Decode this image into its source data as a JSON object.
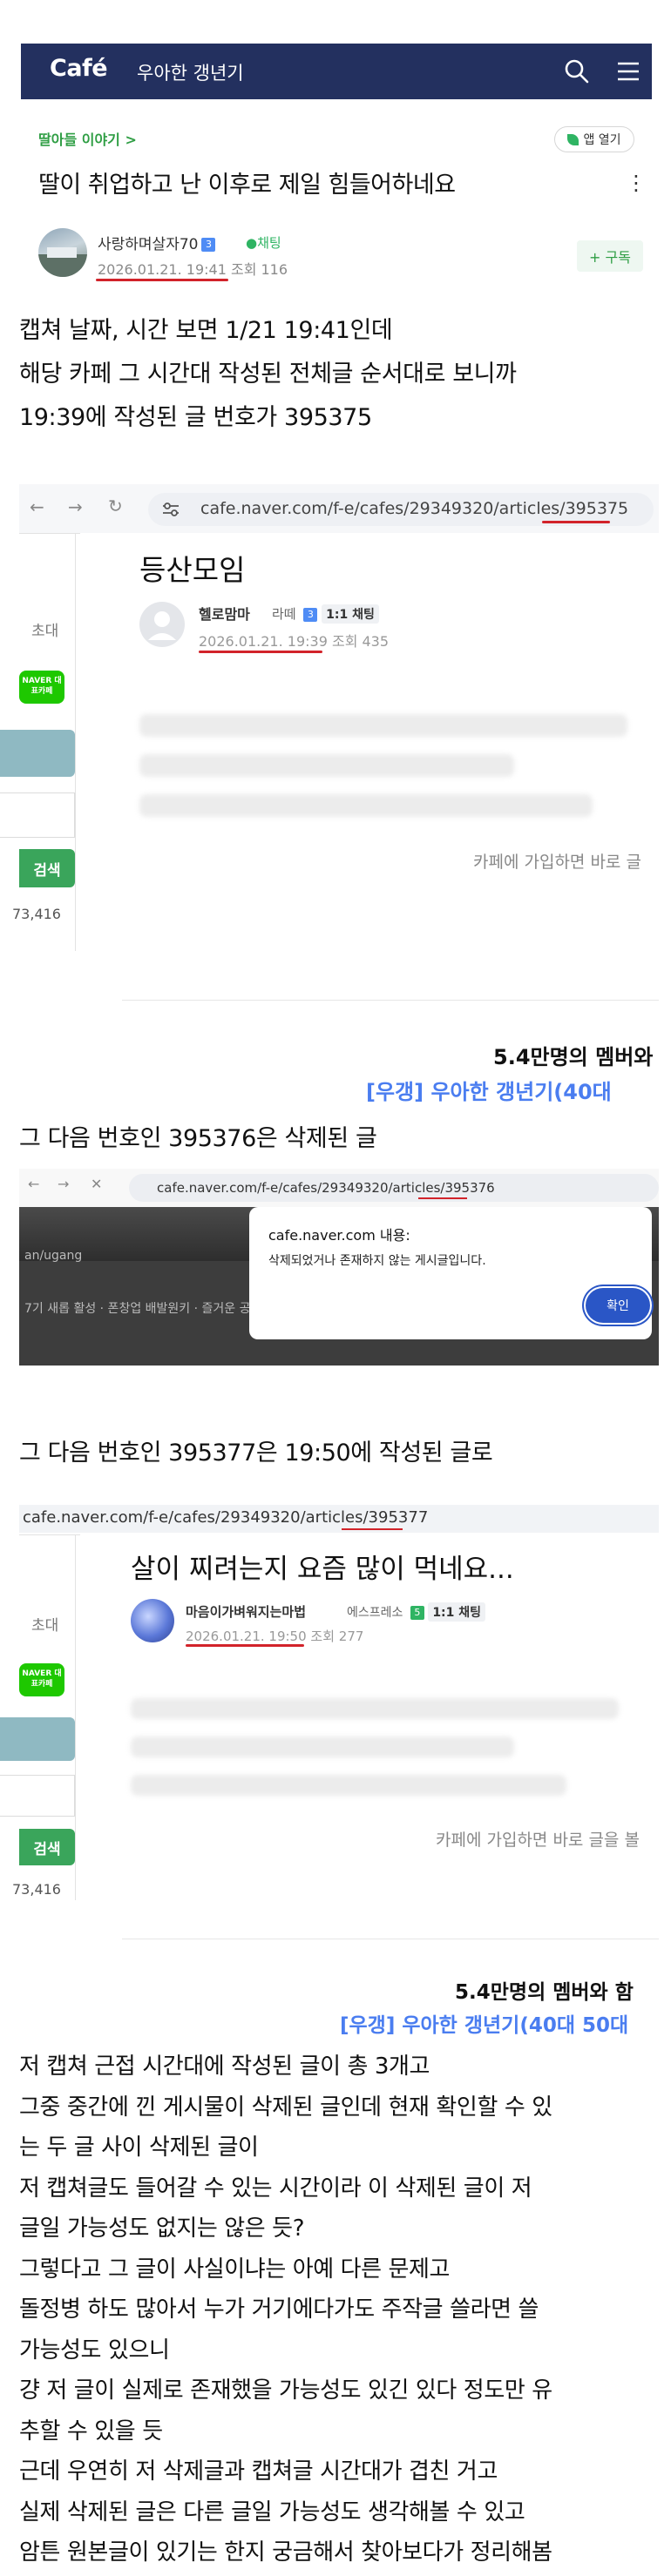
{
  "header": {
    "logo": "Café",
    "cafe_title": "우아한 갱년기",
    "search_icon": "search-icon",
    "menu_icon": "hamburger-menu-icon"
  },
  "post": {
    "board": "딸아들 이야기 >",
    "app_button": "앱 열기",
    "title": "딸이 취업하고 난 이후로 제일 힘들어하네요",
    "more": "⋮",
    "author": "사랑하며살자70",
    "author_level": "3",
    "chat_label": "채팅",
    "meta": "2026.01.21. 19:41  조회 116",
    "subscribe": "+ 구독"
  },
  "body_intro": [
    "캡쳐 날짜, 시간 보면 1/21 19:41인데",
    "해당 카페 그 시간대 작성된 전체글 순서대로 보니까",
    "19:39에 작성된 글 번호가 395375"
  ],
  "shot1": {
    "url": "cafe.naver.com/f-e/cafes/29349320/articles/395375",
    "title": "등산모임",
    "author": "헬로맘마",
    "grade": "라떼",
    "level": "3",
    "chat": "1:1 채팅",
    "meta": "2026.01.21. 19:39  조회 435",
    "side_label": "초대",
    "naver_badge": "NAVER 대표카페",
    "search": "검색",
    "count": "73,416",
    "join_text": "카페에 가입하면 바로 글",
    "member_text": "5.4만명의 멤버와",
    "cafe_name": "[우갱] 우아한 갱년기(40대"
  },
  "line_2": "그 다음 번호인 395376은 삭제된 글",
  "shot2": {
    "url": "cafe.naver.com/f-e/cafes/29349320/articles/395376",
    "bg_text_1": "an/ugang",
    "bg_text_2": "7기 새롭 활성 · 폰창업 배발원키 · 즐거운 공간 놀이",
    "dialog_domain": "cafe.naver.com 내용:",
    "dialog_msg": "삭제되었거나 존재하지 않는 게시글입니다.",
    "ok": "확인"
  },
  "line_3": "그 다음 번호인 395377은 19:50에 작성된 글로",
  "shot3": {
    "url": "cafe.naver.com/f-e/cafes/29349320/articles/395377",
    "title": "살이 찌려는지 요즘 많이 먹네요...",
    "author": "마음이가벼워지는마법",
    "grade": "에스프레소",
    "level": "5",
    "chat": "1:1 채팅",
    "meta": "2026.01.21. 19:50  조회 277",
    "side_label": "초대",
    "naver_badge": "NAVER 대표카페",
    "search": "검색",
    "count": "73,416",
    "join_text": "카페에 가입하면 바로 글을 볼",
    "member_text": "5.4만명의 멤버와 함",
    "cafe_name": "[우갱] 우아한 갱년기(40대 50대"
  },
  "body_outro": [
    "저 캡쳐 근접 시간대에 작성된 글이 총 3개고",
    "그중 중간에 낀 게시물이 삭제된 글인데 현재 확인할 수 있",
    "는 두 글 사이 삭제된 글이",
    "저 캡쳐글도 들어갈 수 있는 시간이라 이 삭제된 글이 저",
    "글일 가능성도 없지는 않은 듯?",
    "그렇다고 그 글이 사실이냐는 아예 다른 문제고",
    "돌정병 하도 많아서 누가 거기에다가도 주작글 쓸라면 쓸",
    "가능성도 있으니",
    "걍 저 글이 실제로 존재했을 가능성도 있긴 있다 정도만 유",
    "추할 수 있을 듯",
    "근데 우연히 저 삭제글과 캡쳐글 시간대가 겹친 거고",
    "실제 삭제된 글은 다른 글일 가능성도 생각해볼 수 있고",
    "암튼 원본글이 있기는 한지 궁금해서 찾아보다가 정리해봄"
  ],
  "colors": {
    "header_bg": "#23305f",
    "green": "#2f9e44",
    "red_underline": "#d2232a",
    "link_blue": "#4a7df0",
    "dialog_button": "#2a56c6"
  }
}
